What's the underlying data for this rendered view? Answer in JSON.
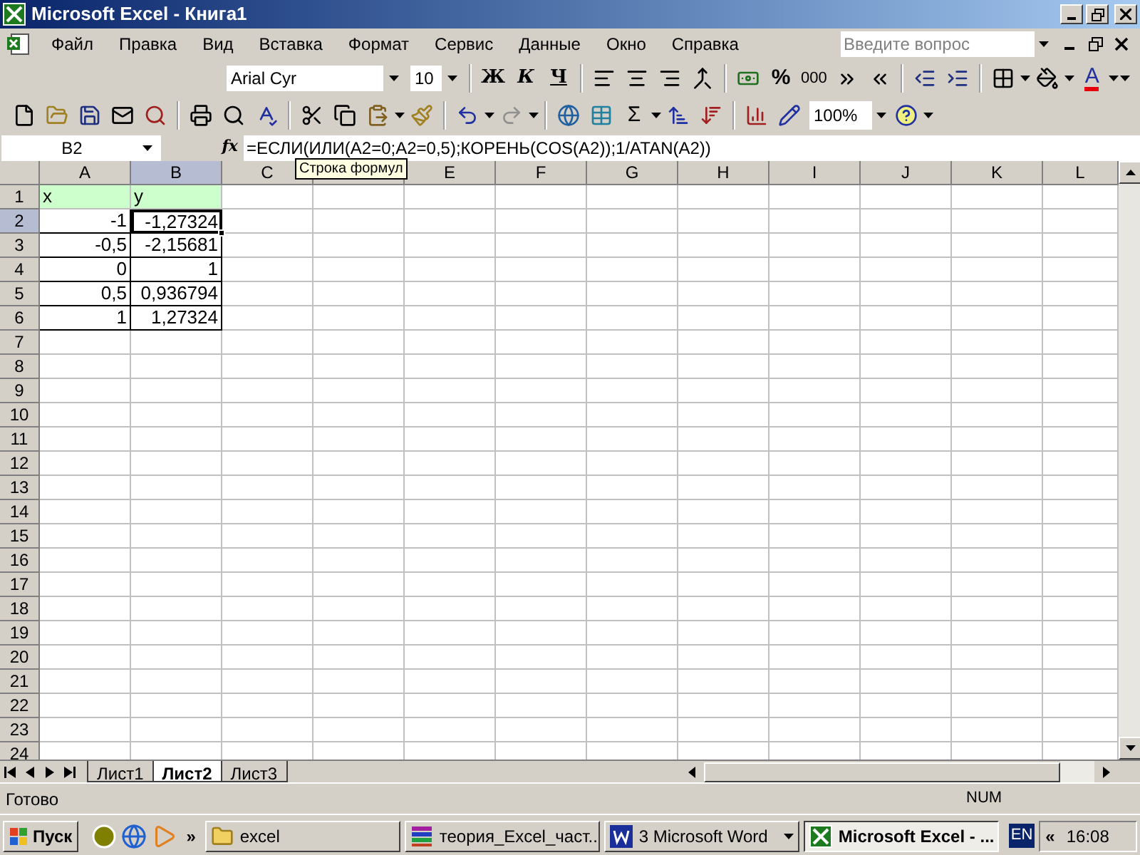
{
  "window": {
    "title": "Microsoft Excel - Книга1"
  },
  "menu": [
    "Файл",
    "Правка",
    "Вид",
    "Вставка",
    "Формат",
    "Сервис",
    "Данные",
    "Окно",
    "Справка"
  ],
  "question_box": {
    "placeholder": "Введите вопрос"
  },
  "formatting": {
    "font": "Arial Cyr",
    "size": "10",
    "bold": "Ж",
    "italic": "К",
    "underline": "Ч",
    "percent": "%",
    "thousands": "000",
    "font_color": "A"
  },
  "standard": {
    "sum": "Σ",
    "zoom": "100%"
  },
  "formula_bar": {
    "name_box": "B2",
    "fx": "fx",
    "formula": "=ЕСЛИ(ИЛИ(A2=0;A2=0,5);КОРЕНЬ(COS(A2));1/ATAN(A2))",
    "tooltip": "Строка формул"
  },
  "columns": [
    {
      "label": "A",
      "selected": false
    },
    {
      "label": "B",
      "selected": true
    },
    {
      "label": "C",
      "selected": false
    },
    {
      "selected": false
    },
    {
      "label": "E",
      "selected": false
    },
    {
      "label": "F",
      "selected": false
    },
    {
      "label": "G",
      "selected": false
    },
    {
      "label": "H",
      "selected": false
    },
    {
      "label": "I",
      "selected": false
    },
    {
      "label": "J",
      "selected": false
    },
    {
      "label": "K",
      "selected": false
    },
    {
      "label": "L",
      "selected": false
    }
  ],
  "rows": [
    {
      "label": "1",
      "selected": false,
      "cells": [
        {
          "text": "x",
          "kind": "label"
        },
        {
          "text": "y",
          "kind": "label"
        }
      ]
    },
    {
      "label": "2",
      "selected": true,
      "cells": [
        {
          "text": "-1",
          "kind": "number"
        },
        {
          "text": "-1,27324",
          "kind": "number"
        }
      ]
    },
    {
      "label": "3",
      "selected": false,
      "cells": [
        {
          "text": "-0,5",
          "kind": "number"
        },
        {
          "text": "-2,15681",
          "kind": "number"
        }
      ]
    },
    {
      "label": "4",
      "selected": false,
      "cells": [
        {
          "text": "0",
          "kind": "number"
        },
        {
          "text": "1",
          "kind": "number"
        }
      ]
    },
    {
      "label": "5",
      "selected": false,
      "cells": [
        {
          "text": "0,5",
          "kind": "number"
        },
        {
          "text": "0,936794",
          "kind": "number"
        }
      ]
    },
    {
      "label": "6",
      "selected": false,
      "cells": [
        {
          "text": "1",
          "kind": "number"
        },
        {
          "text": "1,27324",
          "kind": "number"
        }
      ]
    },
    {
      "label": "7",
      "selected": false
    },
    {
      "label": "8",
      "selected": false
    },
    {
      "label": "9",
      "selected": false
    },
    {
      "label": "10",
      "selected": false
    },
    {
      "label": "11",
      "selected": false
    },
    {
      "label": "12",
      "selected": false
    },
    {
      "label": "13",
      "selected": false
    },
    {
      "label": "14",
      "selected": false
    },
    {
      "label": "15",
      "selected": false
    },
    {
      "label": "16",
      "selected": false
    },
    {
      "label": "17",
      "selected": false
    },
    {
      "label": "18",
      "selected": false
    },
    {
      "label": "19",
      "selected": false
    },
    {
      "label": "20",
      "selected": false
    },
    {
      "label": "21",
      "selected": false
    },
    {
      "label": "22",
      "selected": false
    },
    {
      "label": "23",
      "selected": false
    },
    {
      "label": "24",
      "selected": false
    }
  ],
  "sheet_tabs": [
    {
      "label": "Лист1",
      "selected": false
    },
    {
      "label": "Лист2",
      "selected": true
    },
    {
      "label": "Лист3",
      "selected": false
    }
  ],
  "status_bar": {
    "text": "Готово",
    "indicator": "NUM"
  },
  "taskbar": {
    "start": "Пуск",
    "more": "»",
    "tasks": [
      {
        "label": "excel",
        "kind": "folder",
        "selected": false
      },
      {
        "label": "теория_Excel_част...",
        "kind": "archive",
        "selected": false
      },
      {
        "label": "3 Microsoft Word",
        "kind": "word",
        "selected": false
      },
      {
        "label": "Microsoft Excel - ...",
        "kind": "excel",
        "selected": true
      }
    ],
    "language": "EN",
    "tray_toggle": "«",
    "clock": "16:08"
  }
}
